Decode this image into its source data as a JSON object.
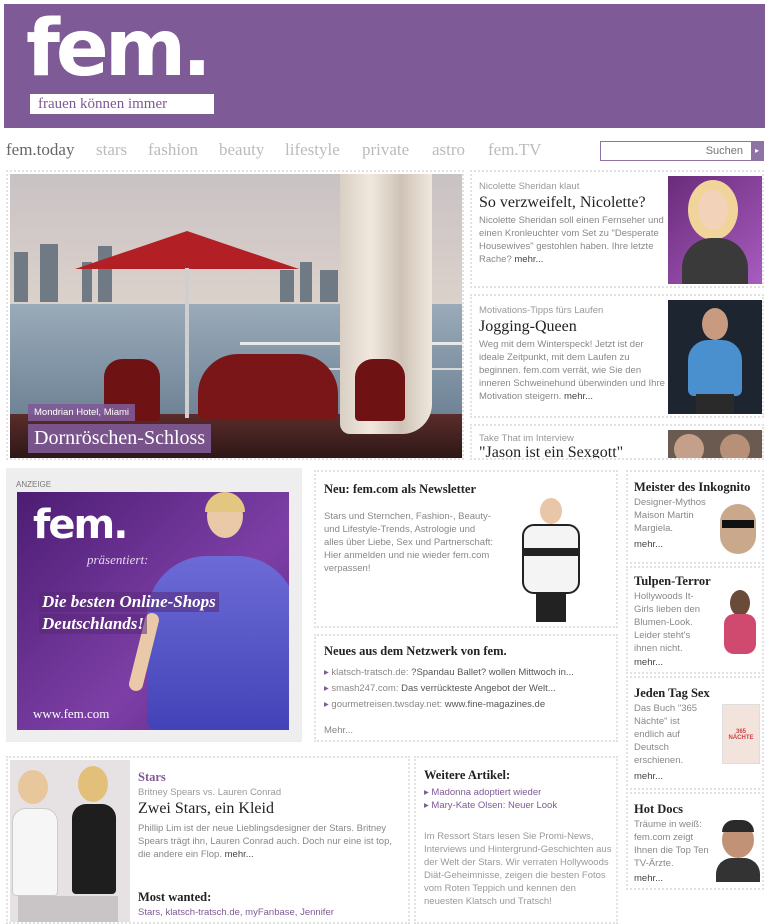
{
  "header": {
    "logo": "fem.",
    "tagline": "frauen können immer"
  },
  "nav": {
    "items": [
      "fem.today",
      "stars",
      "fashion",
      "beauty",
      "lifestyle",
      "private",
      "astro",
      "fem.TV"
    ],
    "search_placeholder": "Suchen"
  },
  "hero": {
    "kicker": "Mondrian Hotel, Miami",
    "title": "Dornröschen-Schloss"
  },
  "teasers": [
    {
      "kicker": "Nicolette Sheridan klaut",
      "title": "So verzweifelt, Nicolette?",
      "text": "Nicolette Sheridan soll einen Fernseher und einen Kronleuchter vom Set zu \"Desperate Housewives\" gestohlen haben. Ihre letzte Rache?",
      "more": "mehr..."
    },
    {
      "kicker": "Motivations-Tipps fürs Laufen",
      "title": "Jogging-Queen",
      "text": "Weg mit dem Winterspeck! Jetzt ist der ideale Zeitpunkt, mit dem Laufen zu beginnen. fem.com verrät, wie Sie den inneren Schweinehund überwinden und Ihre Motivation steigern.",
      "more": "mehr..."
    },
    {
      "kicker": "Take That im Interview",
      "title": "\"Jason ist ein Sexgott\""
    }
  ],
  "ad": {
    "label": "ANZEIGE",
    "logo": "fem.",
    "presents": "präsentiert:",
    "line1_a": "Die besten ",
    "line1_b": "Online-Shops",
    "line2": "Deutschlands!",
    "url": "www.fem.com"
  },
  "newsletter": {
    "title": "Neu: fem.com als Newsletter",
    "text": "Stars und Sternchen, Fashion-, Beauty- und Lifestyle-Trends, Astrologie und alles über Liebe, Sex und Partnerschaft: Hier anmelden und nie wieder fem.com verpassen!"
  },
  "network": {
    "title": "Neues aus dem Netzwerk von fem.",
    "items": [
      {
        "source": "klatsch-tratsch.de:",
        "text": "?Spandau Ballet? wollen Mittwoch in..."
      },
      {
        "source": "smash247.com:",
        "text": "Das verrückteste Angebot der Welt..."
      },
      {
        "source": "gourmetreisen.twsday.net:",
        "text": "www.fine-magazines.de"
      }
    ],
    "more": "Mehr..."
  },
  "side": [
    {
      "title": "Meister des Inkognito",
      "text": "Designer-Mythos Maison Martin Margiela.",
      "more": "mehr..."
    },
    {
      "title": "Tulpen-Terror",
      "text": "Hollywoods It-Girls lieben den Blumen-Look. Leider steht's ihnen nicht.",
      "more": "mehr..."
    },
    {
      "title": "Jeden Tag Sex",
      "text": "Das Buch \"365 Nächte\" ist endlich auf Deutsch erschienen.",
      "more": "mehr...",
      "book": "365 NÄCHTE"
    },
    {
      "title": "Hot Docs",
      "text": "Träume in weiß: fem.com zeigt Ihnen die Top Ten TV-Ärzte.",
      "more": "mehr..."
    }
  ],
  "stars": {
    "section": "Stars",
    "kicker": "Britney Spears vs. Lauren Conrad",
    "title": "Zwei Stars, ein Kleid",
    "text": "Phillip Lim ist der neue Lieblingsdesigner der Stars. Britney Spears trägt ihn, Lauren Conrad auch. Doch nur eine ist top, die andere ein Flop.",
    "more": "mehr...",
    "most_title": "Most wanted:",
    "most_text": "Stars, klatsch-tratsch.de, myFanbase, Jennifer"
  },
  "weitere": {
    "title": "Weitere Artikel:",
    "links": [
      "Madonna adoptiert wieder",
      "Mary-Kate Olsen: Neuer Look"
    ],
    "text": "Im Ressort Stars lesen Sie Promi-News, Interviews und Hintergrund-Geschichten aus der Welt der Stars. Wir verraten Hollywoods Diät-Geheimnisse, zeigen die besten Fotos vom Roten Teppich und kennen den neuesten Klatsch und Tratsch!"
  },
  "colors": {
    "brand": "#7e5a96",
    "link": "#7e5a96"
  }
}
